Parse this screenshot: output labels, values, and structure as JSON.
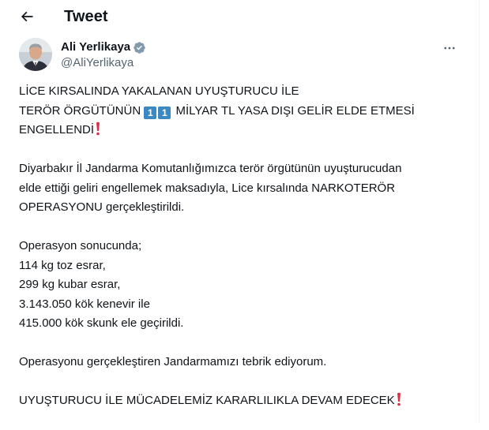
{
  "header": {
    "title": "Tweet",
    "back_icon": "arrow-left-icon"
  },
  "author": {
    "display_name": "Ali Yerlikaya",
    "handle": "@AliYerlikaya",
    "verified_icon": "verified-badge-icon",
    "more_icon": "more-horizontal-icon"
  },
  "tweet": {
    "headline": {
      "line1": "LİCE KIRSALINDA YAKALANAN UYUŞTURUCU İLE",
      "line2_prefix": "TERÖR ÖRGÜTÜNÜN ",
      "keycap_digits": [
        "1",
        "1"
      ],
      "line2_suffix": " MİLYAR TL YASA DIŞI GELİR ELDE ETMESİ",
      "line3": "ENGELLENDİ"
    },
    "intro": {
      "line1": "Diyarbakır İl Jandarma Komutanlığımızca terör örgütünün uyuşturucudan",
      "line2": "elde ettiği geliri engellemek maksadıyla, Lice kırsalında NARKOTERÖR",
      "line3": "OPERASYONU gerçekleştirildi."
    },
    "results": {
      "heading": "Operasyon sonucunda;",
      "items": [
        "114 kg toz esrar,",
        "299 kg kubar esrar,",
        "3.143.050 kök kenevir ile",
        "415.000 kök skunk ele geçirildi."
      ]
    },
    "congrats": "Operasyonu gerçekleştiren Jandarmamızı tebrik ediyorum.",
    "closing": "UYUŞTURUCU İLE MÜCADELEMİZ KARARLILIKLA DEVAM EDECEK",
    "emoji_icon": "red-exclamation-mark-icon"
  },
  "colors": {
    "text": "#0f1419",
    "secondary": "#536471",
    "verified": "#1d9bf0",
    "keycap": "#3b88c3",
    "exclaim": "#dd2e44"
  }
}
